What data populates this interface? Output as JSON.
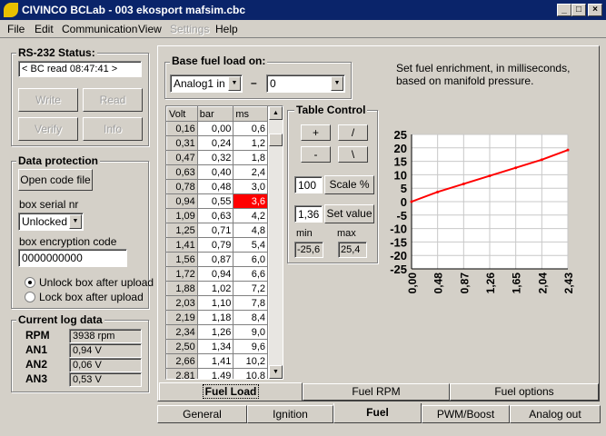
{
  "window": {
    "title": "CIVINCO  BCLab - 003 ekosport mafsim.cbc"
  },
  "menu": [
    "File",
    "Edit",
    "Communication",
    "View",
    "Settings",
    "Help"
  ],
  "rs232": {
    "title": "RS-232 Status:",
    "status": "< BC read 08:47:41 >",
    "write": "Write",
    "read": "Read",
    "verify": "Verify",
    "info": "Info"
  },
  "protection": {
    "title": "Data protection",
    "open_code": "Open code file",
    "serial_label": "box serial nr",
    "serial_value": "Unlocked",
    "enc_label": "box encryption code",
    "enc_value": "0000000000",
    "unlock": "Unlock box after upload",
    "lock": "Lock box after upload"
  },
  "logdata": {
    "title": "Current log data",
    "rows": [
      {
        "label": "RPM",
        "value": "3938 rpm"
      },
      {
        "label": "AN1",
        "value": "0,94 V"
      },
      {
        "label": "AN2",
        "value": "0,06 V"
      },
      {
        "label": "AN3",
        "value": "0,53 V"
      }
    ]
  },
  "base": {
    "title": "Base fuel load on:",
    "source": "Analog1 in",
    "dash": "–",
    "value": "0",
    "hint": "Set fuel enrichment, in milliseconds, based on manifold pressure."
  },
  "table": {
    "headers": [
      "Volt",
      "bar",
      "ms"
    ],
    "rows": [
      [
        "0,16",
        "0,00",
        "0,6"
      ],
      [
        "0,31",
        "0,24",
        "1,2"
      ],
      [
        "0,47",
        "0,32",
        "1,8"
      ],
      [
        "0,63",
        "0,40",
        "2,4"
      ],
      [
        "0,78",
        "0,48",
        "3,0"
      ],
      [
        "0,94",
        "0,55",
        "3,6"
      ],
      [
        "1,09",
        "0,63",
        "4,2"
      ],
      [
        "1,25",
        "0,71",
        "4,8"
      ],
      [
        "1,41",
        "0,79",
        "5,4"
      ],
      [
        "1,56",
        "0,87",
        "6,0"
      ],
      [
        "1,72",
        "0,94",
        "6,6"
      ],
      [
        "1,88",
        "1,02",
        "7,2"
      ],
      [
        "2,03",
        "1,10",
        "7,8"
      ],
      [
        "2,19",
        "1,18",
        "8,4"
      ],
      [
        "2,34",
        "1,26",
        "9,0"
      ],
      [
        "2,50",
        "1,34",
        "9,6"
      ],
      [
        "2,66",
        "1,41",
        "10,2"
      ],
      [
        "2,81",
        "1,49",
        "10,8"
      ]
    ],
    "highlight_row": 5
  },
  "control": {
    "title": "Table Control",
    "plus": "+",
    "slash": "/",
    "minus": "-",
    "backslash": "\\",
    "scale_value": "100",
    "scale_btn": "Scale %",
    "set_value": "1,36",
    "set_btn": "Set value",
    "min_label": "min",
    "max_label": "max",
    "min_value": "-25,6",
    "max_value": "25,4"
  },
  "chart_data": {
    "type": "line",
    "x": [
      "0,00",
      "0,48",
      "0,87",
      "1,26",
      "1,65",
      "2,04",
      "2,43"
    ],
    "series": [
      {
        "values": [
          0,
          3.6,
          6.6,
          9.6,
          12.6,
          15.6,
          19.2
        ],
        "color": "#ff0000"
      }
    ],
    "yticks": [
      25,
      20,
      15,
      10,
      5,
      0,
      -5,
      -10,
      -15,
      -20,
      -25
    ],
    "ylim": [
      -25,
      25
    ],
    "grid": true
  },
  "tabs_inner": [
    "Fuel Load",
    "Fuel RPM",
    "Fuel options"
  ],
  "tabs_outer": [
    "General",
    "Ignition",
    "Fuel",
    "PWM/Boost",
    "Analog out"
  ]
}
